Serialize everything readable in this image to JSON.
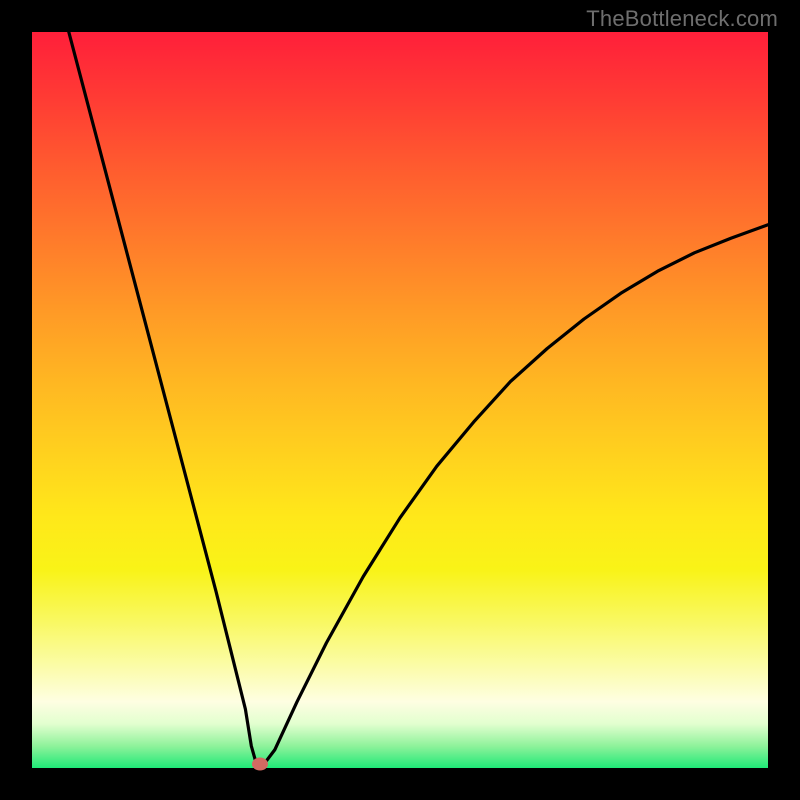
{
  "watermark": "TheBottleneck.com",
  "colors": {
    "gradient_top": "#ff1f3a",
    "gradient_bottom": "#1fe977",
    "curve_stroke": "#000000",
    "marker_fill": "#d36a62",
    "frame_bg": "#000000",
    "watermark_color": "#6e6e6e"
  },
  "chart_data": {
    "type": "line",
    "title": "",
    "xlabel": "",
    "ylabel": "",
    "xlim": [
      0,
      100
    ],
    "ylim": [
      0,
      100
    ],
    "grid": false,
    "series": [
      {
        "name": "bottleneck-curve",
        "x": [
          5,
          10,
          15,
          20,
          25,
          27,
          29,
          29.8,
          30.5,
          31.5,
          33,
          36,
          40,
          45,
          50,
          55,
          60,
          65,
          70,
          75,
          80,
          85,
          90,
          95,
          100
        ],
        "y": [
          100,
          81,
          62,
          43,
          24,
          16,
          8,
          3,
          0.5,
          0.5,
          2.5,
          9,
          17,
          26,
          34,
          41,
          47,
          52.5,
          57,
          61,
          64.5,
          67.5,
          70,
          72,
          73.8
        ]
      }
    ],
    "marker": {
      "x": 31,
      "y": 0.5
    },
    "annotations": []
  }
}
